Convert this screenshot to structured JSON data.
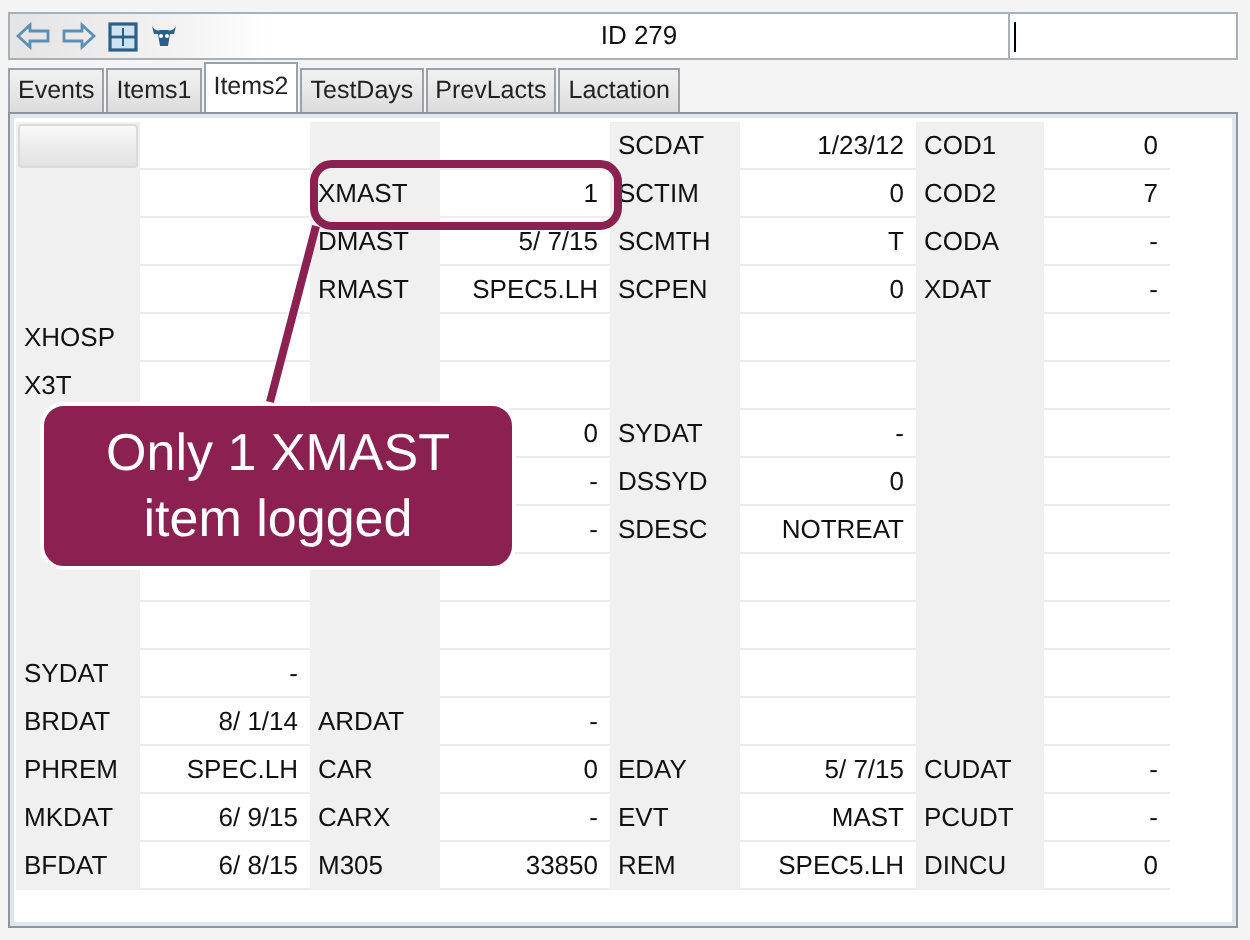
{
  "toolbar": {
    "record_id": "ID 279"
  },
  "tabs": [
    {
      "label": "Events",
      "selected": false
    },
    {
      "label": "Items1",
      "selected": false
    },
    {
      "label": "Items2",
      "selected": true
    },
    {
      "label": "TestDays",
      "selected": false
    },
    {
      "label": "PrevLacts",
      "selected": false
    },
    {
      "label": "Lactation",
      "selected": false
    }
  ],
  "grid": {
    "rows": [
      [
        {},
        {},
        {
          "label": "SCDAT",
          "value": "1/23/12"
        },
        {
          "label": "COD1",
          "value": "0"
        }
      ],
      [
        {},
        {
          "label": "XMAST",
          "value": "1",
          "highlighted": true
        },
        {
          "label": "SCTIM",
          "value": "0"
        },
        {
          "label": "COD2",
          "value": "7"
        }
      ],
      [
        {},
        {
          "label": "DMAST",
          "value": "5/ 7/15"
        },
        {
          "label": "SCMTH",
          "value": "T"
        },
        {
          "label": "CODA",
          "value": "-"
        }
      ],
      [
        {},
        {
          "label": "RMAST",
          "value": "SPEC5.LH"
        },
        {
          "label": "SCPEN",
          "value": "0"
        },
        {
          "label": "XDAT",
          "value": "-"
        }
      ],
      [
        {
          "label": "XHOSP"
        },
        {},
        {},
        {}
      ],
      [
        {
          "label": "X3T"
        },
        {},
        {},
        {}
      ],
      [
        {},
        {
          "value": "0"
        },
        {
          "label": "SYDAT",
          "value": "-"
        },
        {}
      ],
      [
        {},
        {
          "value": "-"
        },
        {
          "label": "DSSYD",
          "value": "0"
        },
        {}
      ],
      [
        {},
        {
          "value": "-"
        },
        {
          "label": "SDESC",
          "value": "NOTREAT"
        },
        {}
      ],
      [
        {},
        {},
        {},
        {}
      ],
      [
        {},
        {},
        {},
        {}
      ],
      [
        {
          "label": "SYDAT",
          "value": "-"
        },
        {},
        {},
        {}
      ],
      [
        {
          "label": "BRDAT",
          "value": "8/ 1/14"
        },
        {
          "label": "ARDAT",
          "value": "-"
        },
        {},
        {}
      ],
      [
        {
          "label": "PHREM",
          "value": "SPEC.LH"
        },
        {
          "label": "CAR",
          "value": "0"
        },
        {
          "label": "EDAY",
          "value": "5/ 7/15"
        },
        {
          "label": "CUDAT",
          "value": "-"
        }
      ],
      [
        {
          "label": "MKDAT",
          "value": "6/ 9/15"
        },
        {
          "label": "CARX",
          "value": "-"
        },
        {
          "label": "EVT",
          "value": "MAST"
        },
        {
          "label": "PCUDT",
          "value": "-"
        }
      ],
      [
        {
          "label": "BFDAT",
          "value": "6/ 8/15"
        },
        {
          "label": "M305",
          "value": "33850"
        },
        {
          "label": "REM",
          "value": "SPEC5.LH"
        },
        {
          "label": "DINCU",
          "value": "0"
        }
      ]
    ]
  },
  "callout": {
    "lines": [
      "Only 1 XMAST",
      "item logged"
    ]
  }
}
